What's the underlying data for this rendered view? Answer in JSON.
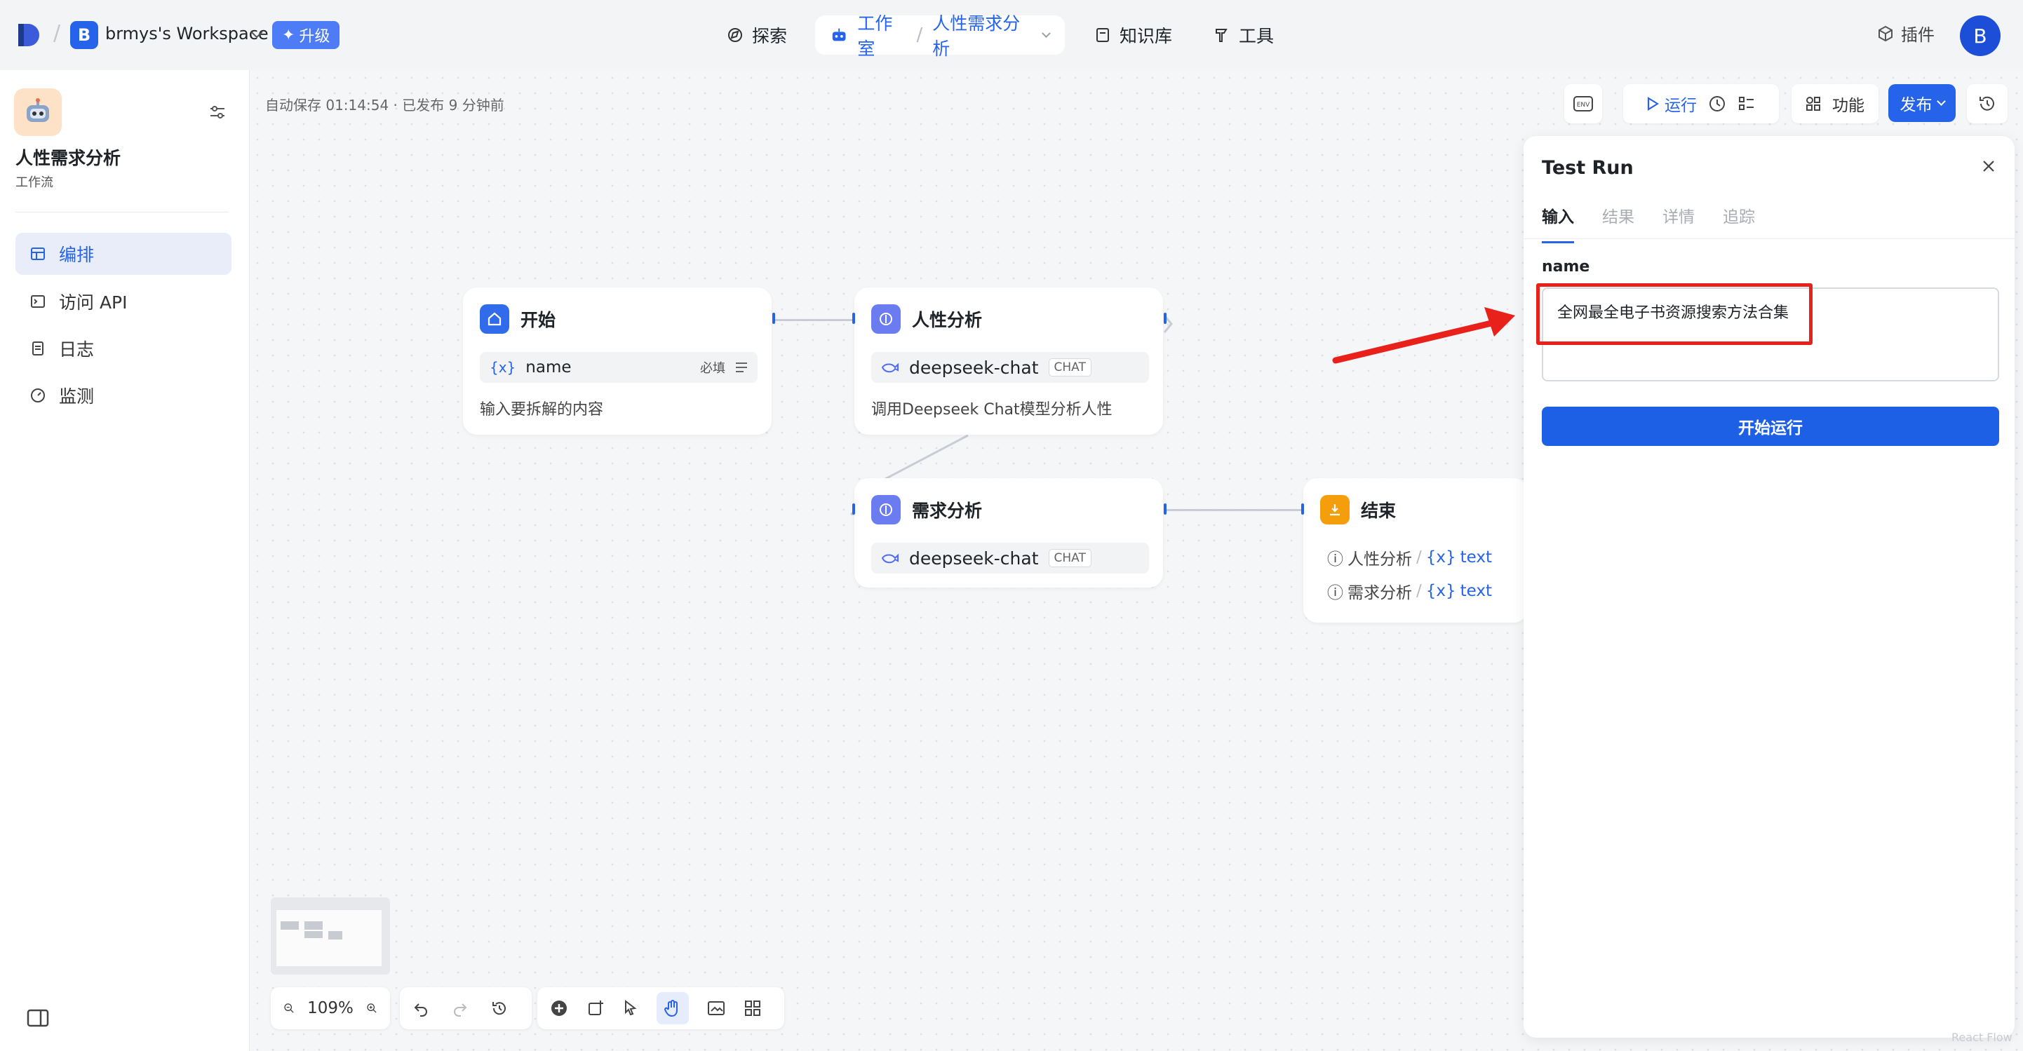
{
  "topbar": {
    "workspace_initial": "B",
    "workspace_name": "brmys's Workspace",
    "upgrade_label": "升级",
    "nav": {
      "explore": "探索",
      "studio": "工作室",
      "project": "人性需求分析",
      "knowledge": "知识库",
      "tools": "工具"
    },
    "plugin_label": "插件",
    "avatar_initial": "B"
  },
  "sidebar": {
    "app_title": "人性需求分析",
    "app_type": "工作流",
    "items": [
      {
        "label": "编排",
        "icon": "layout-icon",
        "active": true
      },
      {
        "label": "访问 API",
        "icon": "terminal-icon",
        "active": false
      },
      {
        "label": "日志",
        "icon": "document-icon",
        "active": false
      },
      {
        "label": "监测",
        "icon": "dashboard-icon",
        "active": false
      }
    ]
  },
  "canvas": {
    "autosave": "自动保存 01:14:54 · 已发布 9 分钟前",
    "toolbar": {
      "env_label": "ENV",
      "run_label": "运行",
      "features_label": "功能",
      "publish_label": "发布"
    },
    "zoom": "109%"
  },
  "nodes": {
    "start": {
      "title": "开始",
      "var": "name",
      "required": "必填",
      "desc": "输入要拆解的内容"
    },
    "human": {
      "title": "人性分析",
      "model": "deepseek-chat",
      "tag": "CHAT",
      "desc": "调用Deepseek Chat模型分析人性"
    },
    "needs": {
      "title": "需求分析",
      "model": "deepseek-chat",
      "tag": "CHAT"
    },
    "end": {
      "title": "结束",
      "rows": [
        {
          "source": "人性分析",
          "var": "text"
        },
        {
          "source": "需求分析",
          "var": "text"
        }
      ]
    }
  },
  "test_run": {
    "title": "Test Run",
    "tabs": [
      "输入",
      "结果",
      "详情",
      "追踪"
    ],
    "field_label": "name",
    "field_value": "全网最全电子书资源搜索方法合集",
    "run_button": "开始运行"
  },
  "colors": {
    "accent": "#2563eb",
    "highlight": "#e8221b",
    "end_node": "#f59e0b",
    "llm_node": "#6b7cf0"
  },
  "watermark": "React Flow"
}
